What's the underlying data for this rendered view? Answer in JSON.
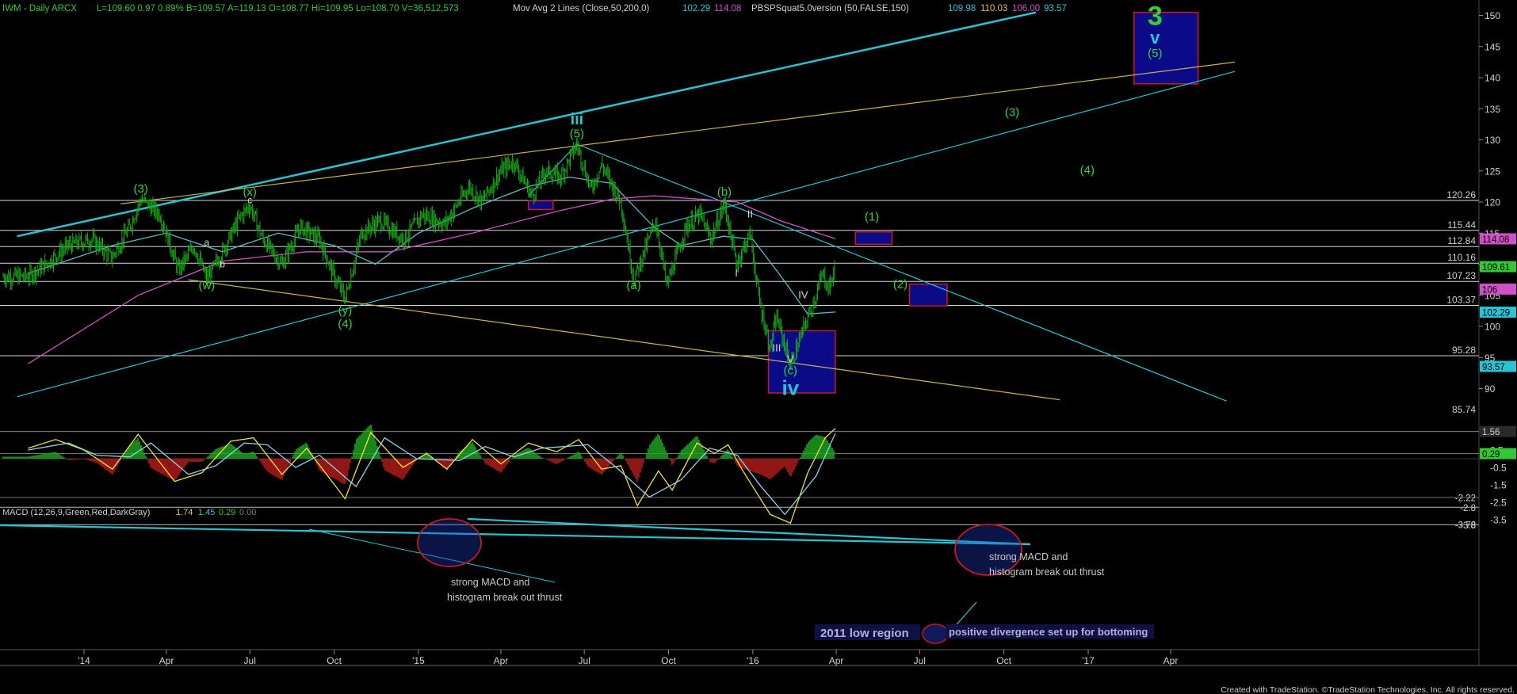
{
  "header": {
    "symbol": "IWM - Daily  ARCX",
    "quote": "L=109.60  0.97  0.89%  B=109.57  A=119.13  O=108.77  Hi=109.95  Lo=108.70  V=36,512,573",
    "mov_avg": "Mov Avg 2 Lines (Close,50,200,0)",
    "mov_avg_values": [
      "102.29",
      "114.08"
    ],
    "indicator": "PBSPSquat5.0version (50,FALSE,150)",
    "indicator_values": [
      "109.98",
      "110.03",
      "106.00",
      "93.57"
    ]
  },
  "macd_header": {
    "label": "MACD (12,26,9,Green,Red,DarkGray)",
    "values": [
      "1.74",
      "1.45",
      "0.29",
      "0.00"
    ]
  },
  "footer": {
    "credit": "Created with TradeStation. ©TradeStation Technologies, Inc. All rights reserved."
  },
  "colors": {
    "background": "#000000",
    "price_bars": "#18a818",
    "cyan": "#27c4d4",
    "yellow": "#c8b24a",
    "magenta": "#d050c8",
    "green_label": "#32d232",
    "blue_box": "#0b0b8a",
    "red_border": "#c81a1a",
    "text": "#c8c8c8"
  },
  "chart_data": [
    {
      "type": "line",
      "title": "IWM - Daily",
      "x_axis_labels": [
        "'14",
        "Apr",
        "Jul",
        "Oct",
        "'15",
        "Apr",
        "Jul",
        "Oct",
        "'16",
        "Apr",
        "Jul",
        "Oct",
        "'17",
        "Apr"
      ],
      "ylim": [
        84,
        153
      ],
      "y_ticks": [
        90,
        95,
        100,
        105,
        110,
        115,
        120,
        125,
        130,
        135,
        140,
        145,
        150
      ],
      "series": [
        {
          "name": "price",
          "points": [
            [
              "2013-11-01",
              108
            ],
            [
              "2013-11-20",
              110
            ],
            [
              "2013-12-15",
              113
            ],
            [
              "2014-01-10",
              114
            ],
            [
              "2014-01-31",
              111
            ],
            [
              "2014-02-20",
              116
            ],
            [
              "2014-03-04",
              120.5
            ],
            [
              "2014-03-25",
              118
            ],
            [
              "2014-04-14",
              109
            ],
            [
              "2014-05-01",
              113
            ],
            [
              "2014-05-15",
              107.5
            ],
            [
              "2014-06-01",
              112
            ],
            [
              "2014-06-20",
              117.5
            ],
            [
              "2014-07-01",
              119.5
            ],
            [
              "2014-07-15",
              114
            ],
            [
              "2014-08-05",
              110
            ],
            [
              "2014-08-25",
              116
            ],
            [
              "2014-09-15",
              114
            ],
            [
              "2014-10-01",
              108
            ],
            [
              "2014-10-13",
              104.5
            ],
            [
              "2014-10-31",
              115
            ],
            [
              "2014-11-20",
              117
            ],
            [
              "2014-12-16",
              114
            ],
            [
              "2015-01-05",
              118
            ],
            [
              "2015-01-30",
              116.5
            ],
            [
              "2015-02-25",
              122.5
            ],
            [
              "2015-03-11",
              120
            ],
            [
              "2015-04-01",
              125
            ],
            [
              "2015-04-15",
              126.5
            ],
            [
              "2015-05-05",
              121
            ],
            [
              "2015-05-20",
              125
            ],
            [
              "2015-06-05",
              124
            ],
            [
              "2015-06-23",
              129.3
            ],
            [
              "2015-07-08",
              122
            ],
            [
              "2015-07-20",
              126
            ],
            [
              "2015-08-10",
              120
            ],
            [
              "2015-08-24",
              107.5
            ],
            [
              "2015-09-17",
              117
            ],
            [
              "2015-09-29",
              106.5
            ],
            [
              "2015-10-20",
              116
            ],
            [
              "2015-11-04",
              118
            ],
            [
              "2015-11-16",
              114
            ],
            [
              "2015-12-01",
              119.8
            ],
            [
              "2015-12-14",
              110
            ],
            [
              "2015-12-29",
              115
            ],
            [
              "2016-01-08",
              104
            ],
            [
              "2016-01-20",
              96.5
            ],
            [
              "2016-01-27",
              101.5
            ],
            [
              "2016-02-11",
              93.7
            ],
            [
              "2016-02-25",
              99.5
            ],
            [
              "2016-03-10",
              105
            ],
            [
              "2016-03-17",
              108.5
            ],
            [
              "2016-03-24",
              106
            ],
            [
              "2016-03-31",
              109.6
            ]
          ]
        },
        {
          "name": "Mov Avg 50",
          "points": [
            [
              "2013-11-01",
              108.5
            ],
            [
              "2014-02-01",
              113
            ],
            [
              "2014-04-01",
              115
            ],
            [
              "2014-06-01",
              112
            ],
            [
              "2014-08-01",
              115
            ],
            [
              "2014-10-01",
              113
            ],
            [
              "2014-11-15",
              110
            ],
            [
              "2015-01-01",
              115
            ],
            [
              "2015-03-01",
              119
            ],
            [
              "2015-05-01",
              122.5
            ],
            [
              "2015-06-15",
              124
            ],
            [
              "2015-07-31",
              123
            ],
            [
              "2015-09-15",
              116
            ],
            [
              "2015-10-15",
              113
            ],
            [
              "2015-11-30",
              114.5
            ],
            [
              "2016-01-01",
              114
            ],
            [
              "2016-02-01",
              108
            ],
            [
              "2016-03-01",
              102
            ],
            [
              "2016-03-31",
              102.3
            ]
          ]
        },
        {
          "name": "Mov Avg 200",
          "points": [
            [
              "2013-11-01",
              94
            ],
            [
              "2014-03-01",
              105
            ],
            [
              "2014-06-01",
              110.5
            ],
            [
              "2014-09-01",
              112
            ],
            [
              "2014-12-01",
              112
            ],
            [
              "2015-03-01",
              115
            ],
            [
              "2015-06-01",
              118.5
            ],
            [
              "2015-08-01",
              120.5
            ],
            [
              "2015-09-15",
              121
            ],
            [
              "2015-11-01",
              120.5
            ],
            [
              "2015-12-15",
              120
            ],
            [
              "2016-01-31",
              117
            ],
            [
              "2016-03-31",
              114.1
            ]
          ]
        }
      ],
      "price_levels": [
        85.74,
        93.57,
        95.28,
        102.29,
        103.37,
        106.0,
        107.23,
        109.61,
        110.16,
        112.84,
        114.08,
        115.44,
        120.26
      ],
      "wave_labels": [
        {
          "text": "(3)",
          "x": "2014-03-04",
          "y": 121.5
        },
        {
          "text": "(x)",
          "x": "2014-07-01",
          "y": 121
        },
        {
          "text": "c",
          "x": "2014-07-01",
          "y": 119.8
        },
        {
          "text": "a",
          "x": "2014-05-15",
          "y": 113
        },
        {
          "text": "b",
          "x": "2014-06-01",
          "y": 109.5
        },
        {
          "text": "(w)",
          "x": "2014-05-15",
          "y": 106
        },
        {
          "text": "(y)",
          "x": "2014-10-13",
          "y": 102
        },
        {
          "text": "(4)",
          "x": "2014-10-13",
          "y": 99.8
        },
        {
          "text": "iii",
          "x": "2015-06-23",
          "y": 132.5
        },
        {
          "text": "(5)",
          "x": "2015-06-23",
          "y": 130.4
        },
        {
          "text": "(a)",
          "x": "2015-08-24",
          "y": 106
        },
        {
          "text": "(b)",
          "x": "2015-12-01",
          "y": 121
        },
        {
          "text": "II",
          "x": "2015-12-29",
          "y": 117.5
        },
        {
          "text": "I",
          "x": "2015-12-14",
          "y": 108
        },
        {
          "text": "IV",
          "x": "2016-02-25",
          "y": 104.5
        },
        {
          "text": "III",
          "x": "2016-01-27",
          "y": 96
        },
        {
          "text": "V",
          "x": "2016-02-11",
          "y": 94.2
        },
        {
          "text": "(c)",
          "x": "2016-02-11",
          "y": 92.3
        },
        {
          "text": "iv",
          "x": "2016-02-11",
          "y": 89
        },
        {
          "text": "(1)",
          "x": "2016-05-10",
          "y": 117
        },
        {
          "text": "(2)",
          "x": "2016-06-10",
          "y": 106.2
        },
        {
          "text": "(3)",
          "x": "2016-10-10",
          "y": 133.8
        },
        {
          "text": "(4)",
          "x": "2016-12-31",
          "y": 124.5
        },
        {
          "text": "3",
          "x": "2017-03-15",
          "y": 148.5
        },
        {
          "text": "v",
          "x": "2017-03-15",
          "y": 145.5
        },
        {
          "text": "(5)",
          "x": "2017-03-15",
          "y": 143.3
        }
      ],
      "target_boxes": [
        {
          "from": "2015-05-01",
          "to": "2015-05-28",
          "low": 118.8,
          "high": 120.2
        },
        {
          "from": "2016-04-22",
          "to": "2016-06-01",
          "low": 113.2,
          "high": 115.2
        },
        {
          "from": "2016-06-20",
          "to": "2016-07-31",
          "low": 103.3,
          "high": 106.8
        },
        {
          "from": "2016-01-18",
          "to": "2016-03-31",
          "low": 89.3,
          "high": 99.3
        },
        {
          "from": "2017-02-20",
          "to": "2017-05-01",
          "low": 139.0,
          "high": 150.5
        }
      ],
      "trend_lines": [
        {
          "color": "cyan",
          "points": [
            [
              "2013-10-20",
              114.5
            ],
            [
              "2016-11-05",
              150.5
            ]
          ]
        },
        {
          "color": "cyan",
          "points": [
            [
              "2013-10-20",
              88.7
            ],
            [
              "2017-06-10",
              141.0
            ]
          ]
        },
        {
          "color": "cyan",
          "points": [
            [
              "2015-06-23",
              129.3
            ],
            [
              "2017-06-01",
              88.0
            ]
          ]
        },
        {
          "color": "yellow",
          "points": [
            [
              "2014-02-10",
              119.7
            ],
            [
              "2017-06-10",
              142.5
            ]
          ]
        },
        {
          "color": "yellow",
          "points": [
            [
              "2014-04-25",
              107.5
            ],
            [
              "2016-12-01",
              88.2
            ]
          ]
        },
        {
          "color": "cyan",
          "points": [
            [
              "2015-05-01",
              121
            ],
            [
              "2015-06-23",
              129.3
            ]
          ]
        }
      ]
    },
    {
      "type": "line",
      "title": "MACD (12,26,9,Green,Red,DarkGray)",
      "ylim": [
        -4.0,
        2.2
      ],
      "y_ticks": [
        1.5,
        0.5,
        -0.5,
        -1.5,
        -2.5,
        -3.5
      ],
      "levels": [
        1.56,
        0.29,
        -2.22,
        -2.8,
        -3.78,
        -3.8
      ],
      "series": [
        {
          "name": "MACD",
          "points": [
            [
              "2013-11-01",
              0.6
            ],
            [
              "2013-12-01",
              1.1
            ],
            [
              "2014-01-01",
              0.5
            ],
            [
              "2014-02-01",
              -0.6
            ],
            [
              "2014-03-01",
              1.4
            ],
            [
              "2014-04-10",
              -1.3
            ],
            [
              "2014-05-10",
              -0.8
            ],
            [
              "2014-06-10",
              1.0
            ],
            [
              "2014-07-05",
              1.2
            ],
            [
              "2014-08-05",
              -0.9
            ],
            [
              "2014-09-01",
              0.6
            ],
            [
              "2014-10-13",
              -2.3
            ],
            [
              "2014-11-10",
              1.5
            ],
            [
              "2014-12-15",
              -0.5
            ],
            [
              "2015-01-10",
              0.3
            ],
            [
              "2015-02-01",
              -0.6
            ],
            [
              "2015-03-01",
              1.1
            ],
            [
              "2015-04-01",
              -0.3
            ],
            [
              "2015-05-01",
              0.9
            ],
            [
              "2015-06-01",
              0.4
            ],
            [
              "2015-06-25",
              1.1
            ],
            [
              "2015-07-20",
              -0.6
            ],
            [
              "2015-08-10",
              -0.4
            ],
            [
              "2015-08-28",
              -2.7
            ],
            [
              "2015-09-20",
              -0.7
            ],
            [
              "2015-10-05",
              -1.8
            ],
            [
              "2015-11-01",
              0.9
            ],
            [
              "2015-11-20",
              0.3
            ],
            [
              "2015-12-05",
              0.8
            ],
            [
              "2015-12-20",
              -0.6
            ],
            [
              "2016-01-20",
              -3.2
            ],
            [
              "2016-02-11",
              -3.7
            ],
            [
              "2016-03-01",
              -0.8
            ],
            [
              "2016-03-20",
              1.2
            ],
            [
              "2016-03-31",
              1.74
            ]
          ]
        },
        {
          "name": "Signal",
          "points": [
            [
              "2013-11-01",
              0.5
            ],
            [
              "2013-12-15",
              0.9
            ],
            [
              "2014-01-15",
              0.2
            ],
            [
              "2014-02-20",
              0.1
            ],
            [
              "2014-03-15",
              0.9
            ],
            [
              "2014-04-25",
              -0.9
            ],
            [
              "2014-05-25",
              -0.4
            ],
            [
              "2014-06-25",
              0.9
            ],
            [
              "2014-07-20",
              0.8
            ],
            [
              "2014-08-20",
              -0.5
            ],
            [
              "2014-09-15",
              0.2
            ],
            [
              "2014-10-25",
              -1.6
            ],
            [
              "2014-11-25",
              1.2
            ],
            [
              "2014-12-30",
              0.0
            ],
            [
              "2015-02-15",
              -0.1
            ],
            [
              "2015-03-15",
              0.7
            ],
            [
              "2015-04-15",
              0.1
            ],
            [
              "2015-05-15",
              0.6
            ],
            [
              "2015-07-05",
              0.8
            ],
            [
              "2015-08-05",
              -0.5
            ],
            [
              "2015-09-10",
              -2.2
            ],
            [
              "2015-10-15",
              -1.2
            ],
            [
              "2015-11-15",
              0.6
            ],
            [
              "2015-12-15",
              0.2
            ],
            [
              "2016-01-10",
              -1.6
            ],
            [
              "2016-02-05",
              -3.2
            ],
            [
              "2016-03-10",
              -1.0
            ],
            [
              "2016-03-31",
              1.45
            ]
          ]
        }
      ],
      "annotations": [
        "strong MACD  and",
        "histogram break out thrust",
        "strong MACD  and",
        "histogram break out thrust",
        "2011 low region",
        "positive divergence set up for bottoming"
      ]
    }
  ]
}
